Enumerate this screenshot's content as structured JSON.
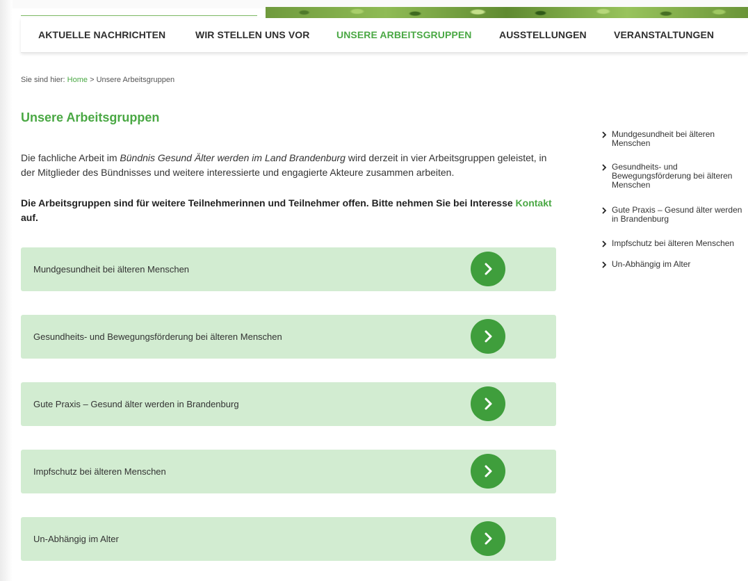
{
  "nav": {
    "items": [
      {
        "label": "AKTUELLE NACHRICHTEN",
        "active": false
      },
      {
        "label": "WIR STELLEN UNS VOR",
        "active": false
      },
      {
        "label": "UNSERE ARBEITSGRUPPEN",
        "active": true
      },
      {
        "label": "AUSSTELLUNGEN",
        "active": false
      },
      {
        "label": "VERANSTALTUNGEN",
        "active": false
      }
    ]
  },
  "breadcrumb": {
    "prefix": "Sie sind hier:",
    "home": "Home",
    "separator": ">",
    "current": "Unsere Arbeitsgruppen"
  },
  "main": {
    "title": "Unsere Arbeitsgruppen",
    "intro": {
      "before": "Die fachliche Arbeit im ",
      "emphasis": "Bündnis Gesund Älter werden im Land Brandenburg",
      "after": " wird  derzeit in vier Arbeitsgruppen geleistet, in der Mitglieder des Bündnisses und weitere interessierte und engagierte Akteure zusammen arbeiten."
    },
    "notice": {
      "text": "Die Arbeitsgruppen sind für weitere Teilnehmerinnen und Teilnehmer offen. Bitte nehmen Sie bei Interesse ",
      "link": "Kontakt",
      "after": " auf."
    },
    "groups": [
      {
        "label": "Mundgesundheit bei älteren Menschen"
      },
      {
        "label": "Gesundheits- und Bewegungsförderung bei älteren Menschen"
      },
      {
        "label": "Gute Praxis – Gesund älter werden in Brandenburg"
      },
      {
        "label": "Impfschutz bei älteren Menschen"
      },
      {
        "label": "Un-Abhängig im Alter"
      }
    ]
  },
  "sidebar": {
    "items": [
      {
        "label": "Mundgesundheit bei älteren Menschen"
      },
      {
        "label": "Gesundheits- und Bewegungsförderung bei älteren Menschen"
      },
      {
        "label": "Gute Praxis – Gesund älter werden in Brandenburg"
      },
      {
        "label": "Impfschutz bei älteren Menschen"
      },
      {
        "label": "Un-Abhängig im Alter"
      }
    ]
  },
  "icons": {
    "group_arrow": "chevron-right-circle-icon",
    "sidebar_bullet": "chevron-right-icon"
  },
  "colors": {
    "accent_green": "#4aa844",
    "button_green": "#3f9e3c",
    "box_background": "#d2ecd1"
  }
}
